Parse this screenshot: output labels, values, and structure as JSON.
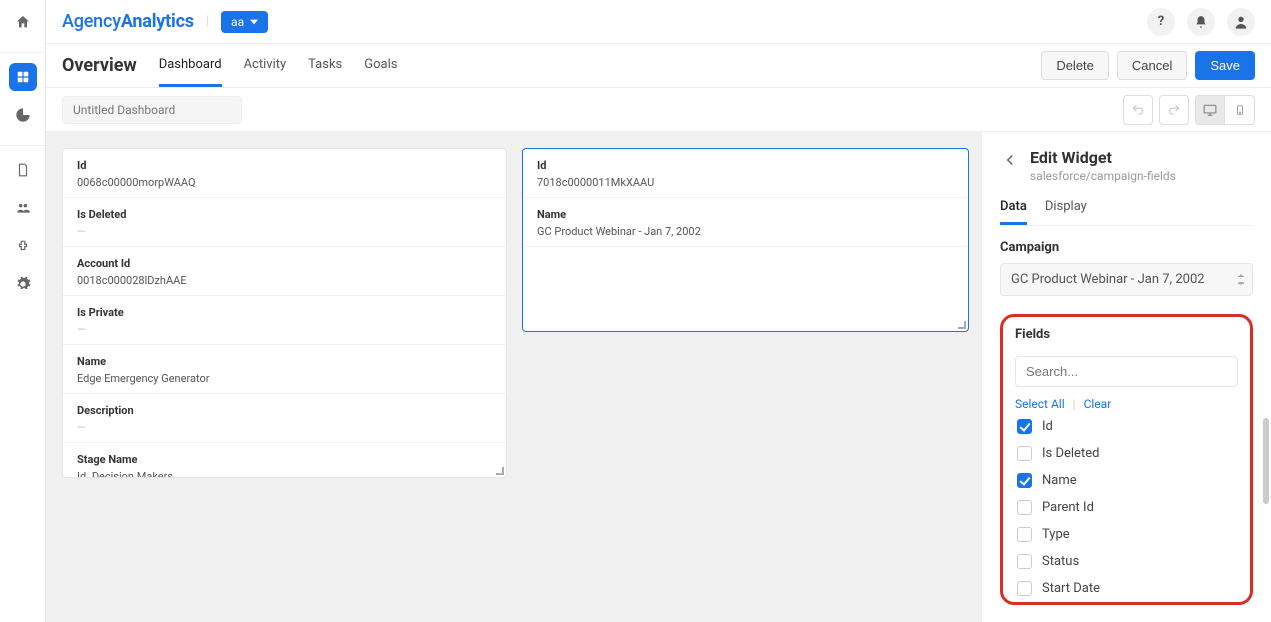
{
  "brand": {
    "part1": "Agency",
    "part2": "Analytics"
  },
  "workspace": "aa",
  "header": {
    "title": "Overview",
    "tabs": [
      "Dashboard",
      "Activity",
      "Tasks",
      "Goals"
    ],
    "active_tab": 0,
    "buttons": {
      "delete": "Delete",
      "cancel": "Cancel",
      "save": "Save"
    }
  },
  "toolbar": {
    "dashboard_name": "Untitled Dashboard"
  },
  "widgets": {
    "left": [
      {
        "label": "Id",
        "value": "0068c00000morpWAAQ"
      },
      {
        "label": "Is Deleted",
        "value": "—",
        "empty": true
      },
      {
        "label": "Account Id",
        "value": "0018c000028lDzhAAE"
      },
      {
        "label": "Is Private",
        "value": "—",
        "empty": true
      },
      {
        "label": "Name",
        "value": "Edge Emergency Generator"
      },
      {
        "label": "Description",
        "value": "—",
        "empty": true
      },
      {
        "label": "Stage Name",
        "value": "Id. Decision Makers"
      }
    ],
    "right": [
      {
        "label": "Id",
        "value": "7018c0000011MkXAAU"
      },
      {
        "label": "Name",
        "value": "GC Product Webinar - Jan 7, 2002"
      }
    ]
  },
  "panel": {
    "title": "Edit Widget",
    "subtitle": "salesforce/campaign-fields",
    "tabs": [
      "Data",
      "Display"
    ],
    "active_tab": 0,
    "campaign_label": "Campaign",
    "campaign_value": "GC Product Webinar - Jan 7, 2002",
    "fields_label": "Fields",
    "search_placeholder": "Search...",
    "select_all": "Select All",
    "clear": "Clear",
    "fields": [
      {
        "label": "Id",
        "checked": true
      },
      {
        "label": "Is Deleted",
        "checked": false
      },
      {
        "label": "Name",
        "checked": true
      },
      {
        "label": "Parent Id",
        "checked": false
      },
      {
        "label": "Type",
        "checked": false
      },
      {
        "label": "Status",
        "checked": false
      },
      {
        "label": "Start Date",
        "checked": false
      }
    ]
  }
}
